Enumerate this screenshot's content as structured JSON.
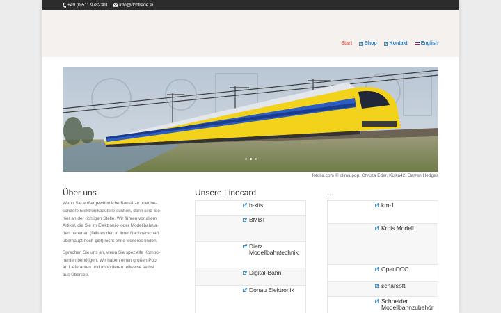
{
  "topbar": {
    "phone": "+49 (0)511 9782301",
    "email": "info@dcctrade.eu",
    "phone_icon": "phone-icon",
    "email_icon": "envelope-icon"
  },
  "nav": {
    "items": [
      {
        "label": "Start",
        "icon": "",
        "active": true
      },
      {
        "label": "Shop",
        "icon": "external-link-icon"
      },
      {
        "label": "Kontakt",
        "icon": "external-link-icon"
      },
      {
        "label": "English",
        "icon": "uk-flag-icon"
      }
    ]
  },
  "colors": {
    "accent": "#2e7fb8",
    "active_nav": "#d26a5a",
    "topbar_bg": "#2c2c2c",
    "header_bg": "#f4f1ef",
    "train_yellow": "#f2d21a",
    "train_blue": "#1c3c8c"
  },
  "slider": {
    "credit": "fotolia.com © olimiupop, Christa Eder, Kiska42, Darren Hedges",
    "slide_count": 3,
    "active_slide": 1
  },
  "about": {
    "title": "Über uns",
    "paragraphs": [
      [
        "Wenn Sie außergewöhnliche Bausätze oder be-",
        "sondere Elektronikbauteile suchen, dann sind Sie",
        "hier an der richtigen Stelle. Wir führen vor allem",
        "Artikel, die Sie im Elektronik- oder Modellbahnla-",
        "den nebenan (falls es den in Ihrer Nachbarschaft",
        "überhaupt noch gibt) nicht ohne weiteres finden."
      ],
      [
        "Sprechen Sie uns an, wenn Sie spezielle Kompo-",
        "nenten benötigen. Wir haben einen großen Pool",
        "an Lieferanten und importieren teilweise selbst",
        "aus Übersee."
      ]
    ]
  },
  "linecard1": {
    "title": "Unsere Linecard",
    "items": [
      {
        "name": [
          "b-kits"
        ]
      },
      {
        "name": [
          "BMBT"
        ]
      },
      {
        "name": [
          "Dietz",
          "Modellbahntechnik"
        ]
      },
      {
        "name": [
          "Digital-Bahn"
        ]
      },
      {
        "name": [
          "Donau Elektronik"
        ]
      }
    ]
  },
  "linecard2": {
    "title": "...",
    "items": [
      {
        "name": [
          "km-1"
        ]
      },
      {
        "name": [
          "Krois Modell"
        ]
      },
      {
        "name": [
          "OpenDCC"
        ]
      },
      {
        "name": [
          "scharsoft"
        ]
      },
      {
        "name": [
          "Schneider",
          "Modellbahnzubehör"
        ]
      }
    ]
  }
}
